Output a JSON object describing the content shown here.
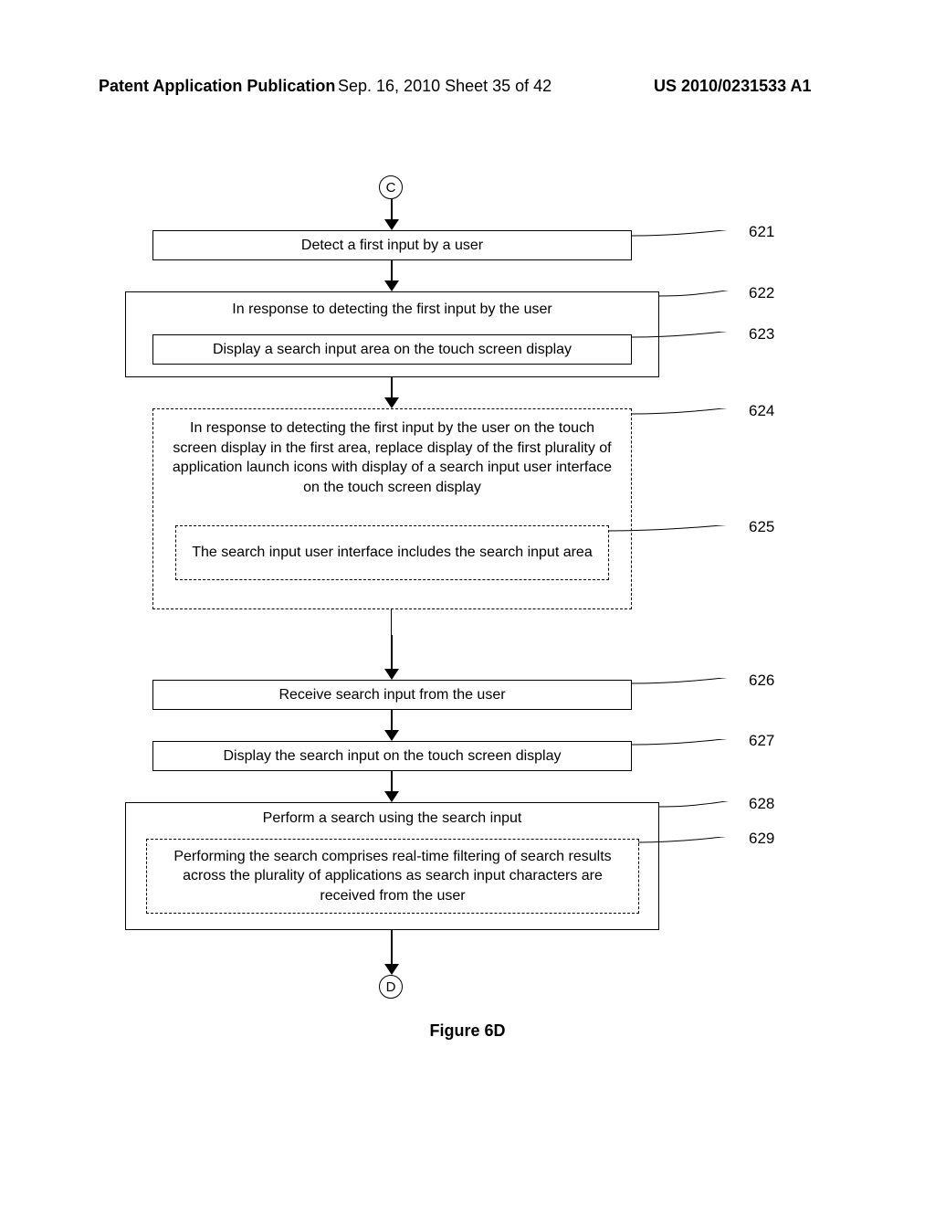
{
  "header": {
    "left": "Patent Application Publication",
    "center": "Sep. 16, 2010  Sheet 35 of 42",
    "right": "US 2010/0231533 A1"
  },
  "flow": {
    "connector_top": "C",
    "connector_bottom": "D",
    "caption": "Figure 6D",
    "boxes": {
      "b621": "Detect a first input by a user",
      "b622": "In response to detecting the first input by the user",
      "b623": "Display a search input area on the touch screen display",
      "b624": "In response to detecting the first input by the user on the touch screen display in the first area, replace display of the first plurality of application launch icons with display of a search input user interface on the touch screen display",
      "b625": "The search input user interface includes the search input area",
      "b626": "Receive search input from the user",
      "b627": "Display the search input on the touch screen display",
      "b628": "Perform a search using the search input",
      "b629": "Performing the search comprises real-time filtering of search results across the plurality of applications as search input characters are received from the user"
    },
    "refs": {
      "r621": "621",
      "r622": "622",
      "r623": "623",
      "r624": "624",
      "r625": "625",
      "r626": "626",
      "r627": "627",
      "r628": "628",
      "r629": "629"
    }
  }
}
